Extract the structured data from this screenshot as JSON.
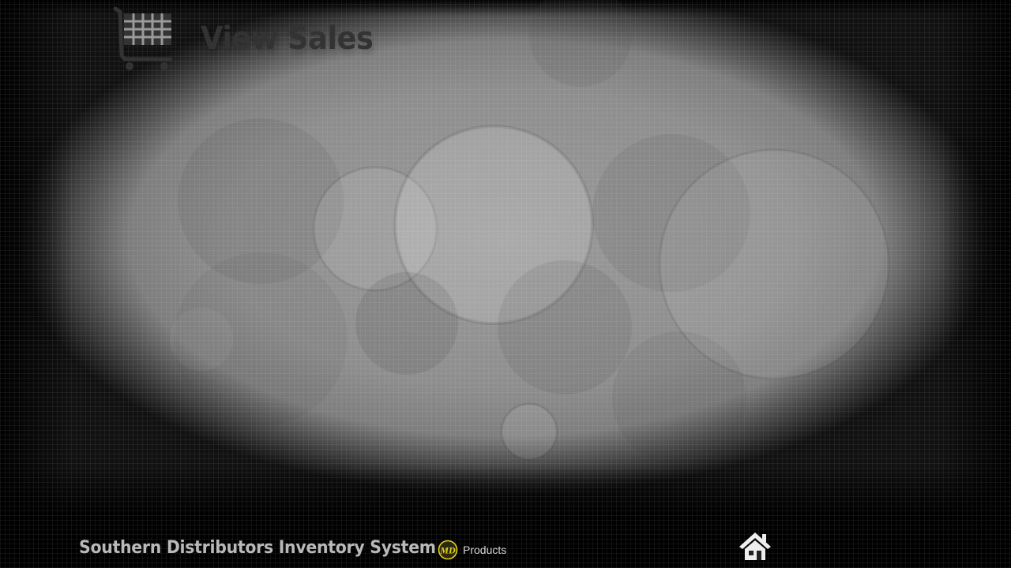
{
  "header": {
    "title": "View Sales",
    "icon": "shopping-cart-icon"
  },
  "footer": {
    "app_name": "Southern Distributors Inventory System",
    "brand_logo_text": "MD",
    "brand_label": "Products",
    "home_icon": "home-icon"
  },
  "colors": {
    "title": "#333333",
    "footer_text": "#b9b9b9",
    "logo_yellow": "#e6d11a"
  }
}
